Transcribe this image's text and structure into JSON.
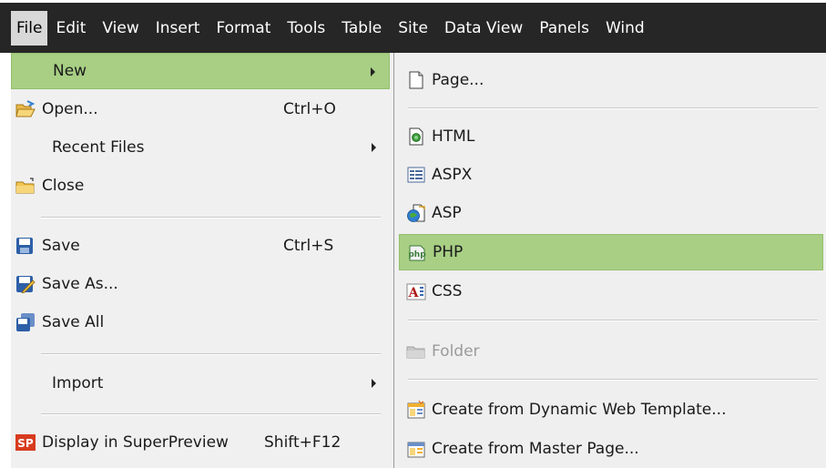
{
  "menubar": {
    "items": [
      "File",
      "Edit",
      "View",
      "Insert",
      "Format",
      "Tools",
      "Table",
      "Site",
      "Data View",
      "Panels",
      "Wind"
    ]
  },
  "file_menu": {
    "new": {
      "label": "New",
      "icon": "none",
      "has_submenu": true
    },
    "open": {
      "label": "Open...",
      "shortcut": "Ctrl+O",
      "icon": "open-folder-icon"
    },
    "recent": {
      "label": "Recent Files",
      "has_submenu": true
    },
    "close": {
      "label": "Close",
      "icon": "close-folder-icon"
    },
    "save": {
      "label": "Save",
      "shortcut": "Ctrl+S",
      "icon": "save-icon"
    },
    "save_as": {
      "label": "Save As...",
      "icon": "save-as-icon"
    },
    "save_all": {
      "label": "Save All",
      "icon": "save-all-icon"
    },
    "import": {
      "label": "Import",
      "has_submenu": true
    },
    "superpreview": {
      "label": "Display in SuperPreview",
      "shortcut": "Shift+F12",
      "icon": "superpreview-icon",
      "icon_text": "SP"
    }
  },
  "new_submenu": {
    "page": {
      "label": "Page...",
      "icon": "page-icon"
    },
    "html": {
      "label": "HTML",
      "icon": "html-icon"
    },
    "aspx": {
      "label": "ASPX",
      "icon": "aspx-icon"
    },
    "asp": {
      "label": "ASP",
      "icon": "asp-icon"
    },
    "php": {
      "label": "PHP",
      "icon": "php-icon",
      "icon_text": "php"
    },
    "css": {
      "label": "CSS",
      "icon": "css-icon",
      "icon_text": "A"
    },
    "folder": {
      "label": "Folder",
      "icon": "folder-icon",
      "disabled": true
    },
    "dwt": {
      "label": "Create from Dynamic Web Template...",
      "icon": "dwt-icon"
    },
    "master": {
      "label": "Create from Master Page...",
      "icon": "master-page-icon"
    }
  },
  "colors": {
    "menubar_bg": "#262626",
    "menu_bg": "#f0f0f0",
    "highlight": "#a8cf84",
    "separator": "#c9c9c9"
  }
}
